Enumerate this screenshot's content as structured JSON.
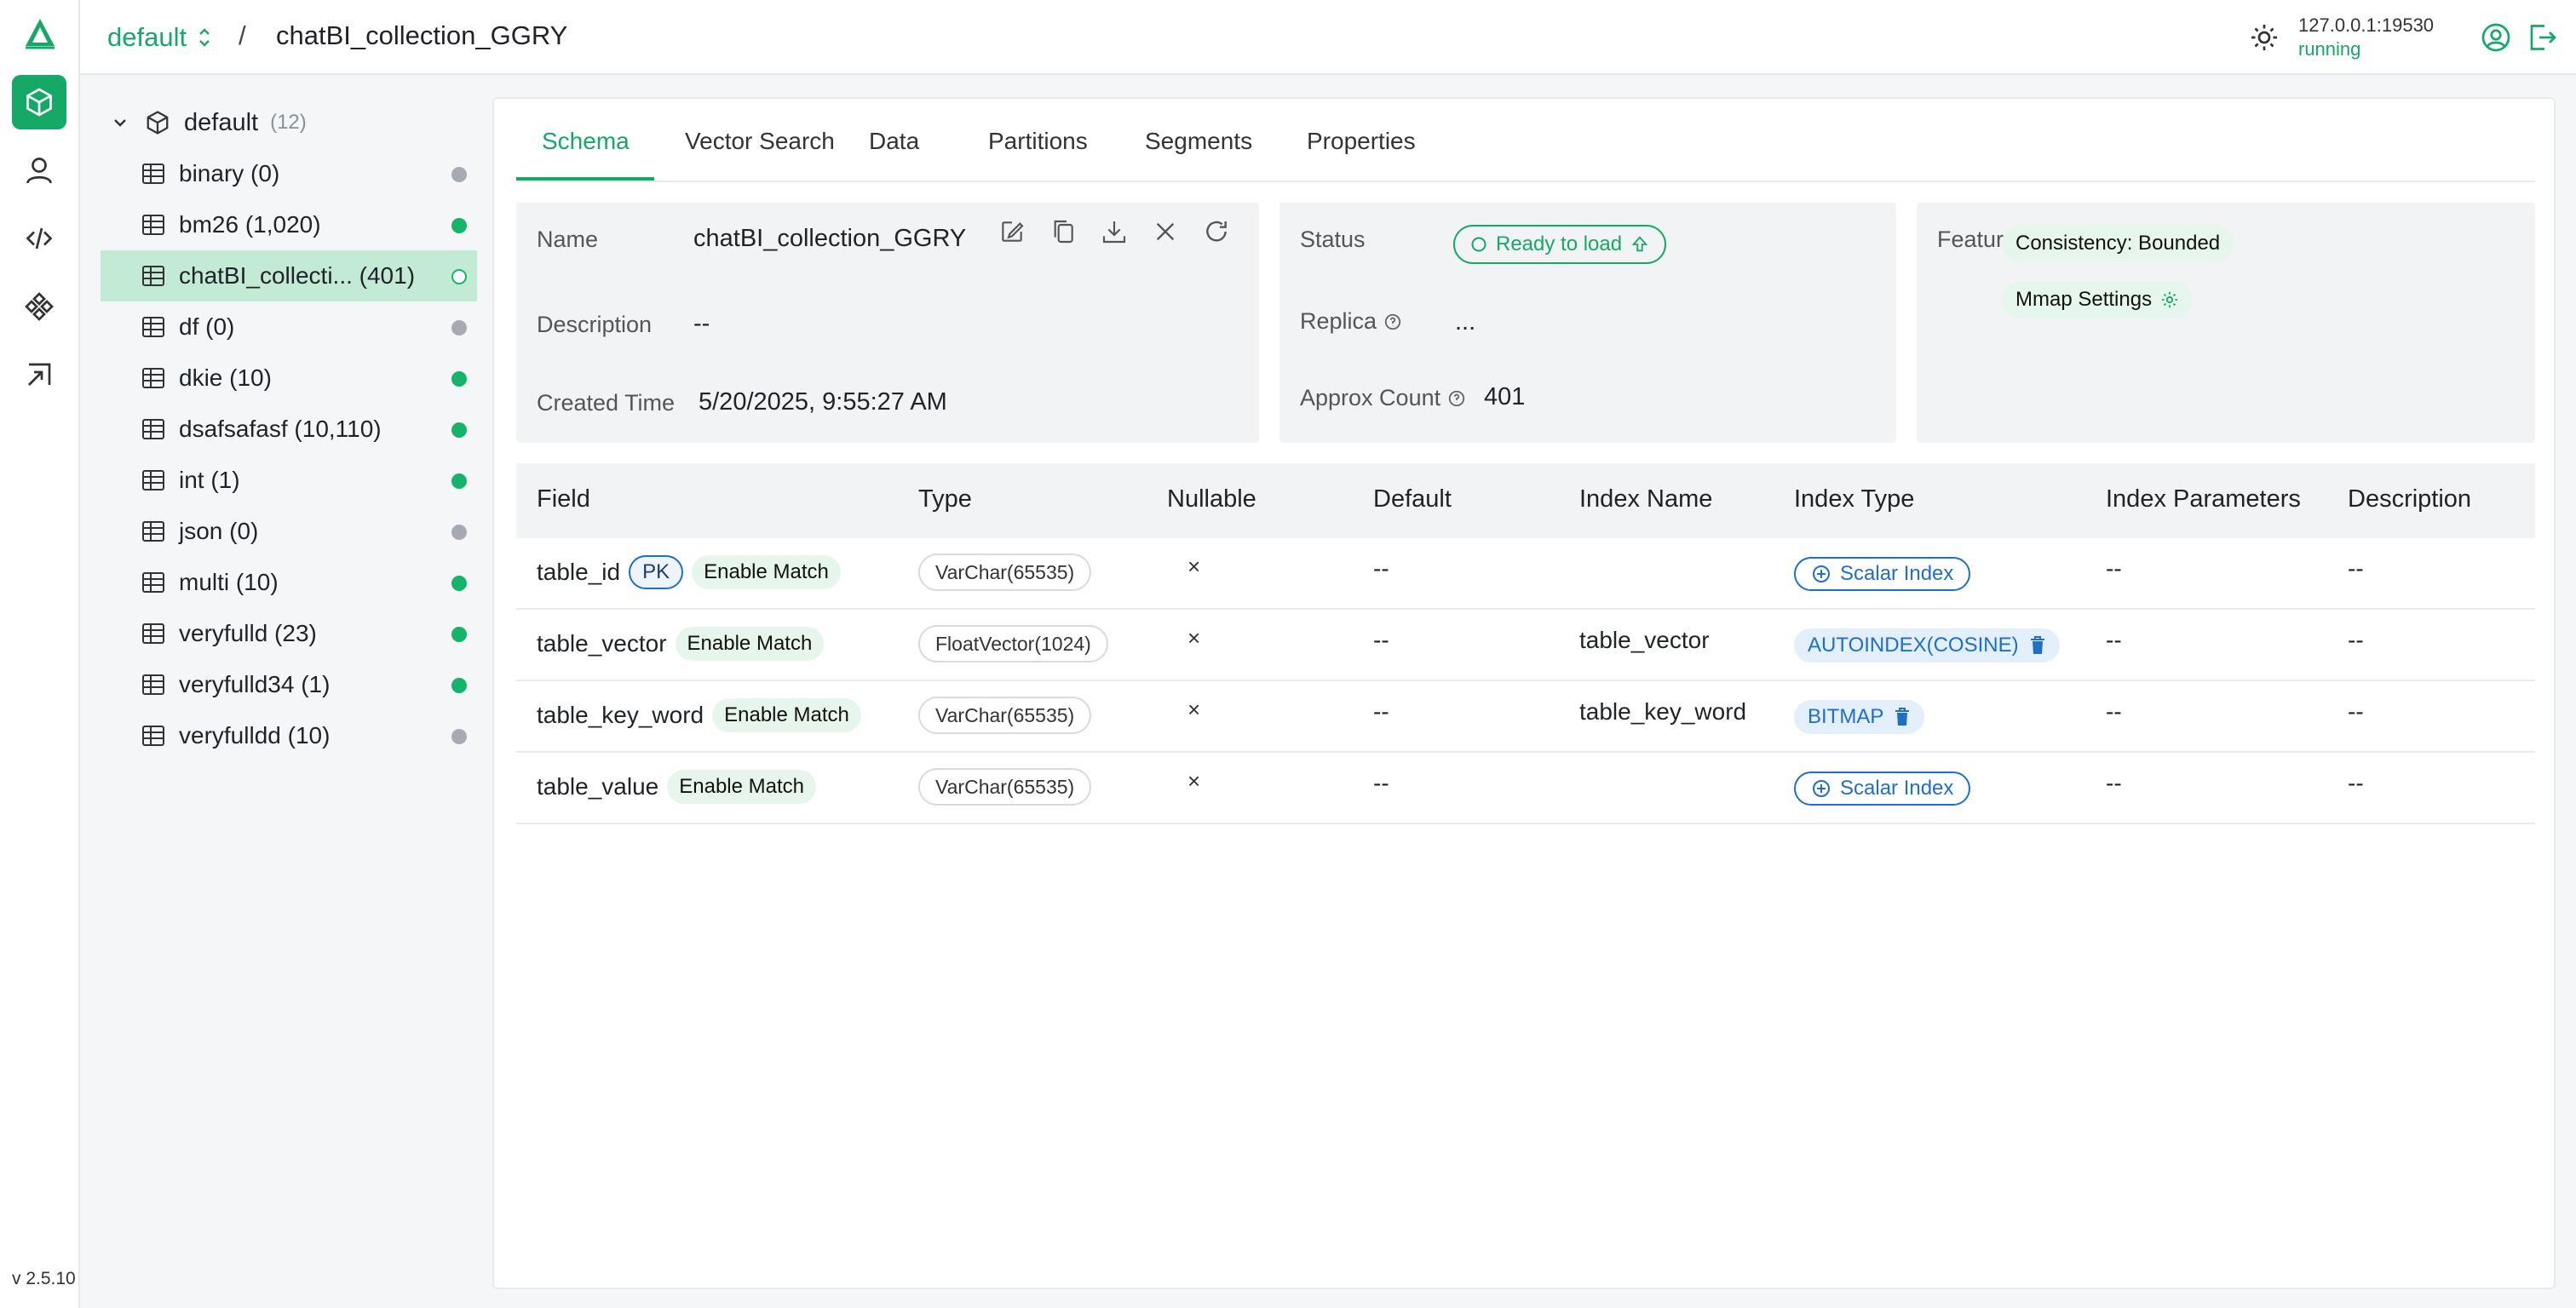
{
  "rail": {
    "version": "v 2.5.10",
    "nav_icons": [
      "collections-icon",
      "user-icon",
      "code-icon",
      "system-icon",
      "slow-query-icon"
    ]
  },
  "header": {
    "database": "default",
    "separator": "/",
    "collection_title": "chatBI_collection_GGRY",
    "server_address": "127.0.0.1:19530",
    "server_status": "running"
  },
  "tree": {
    "root_label": "default",
    "root_count": "(12)",
    "items": [
      {
        "label": "binary",
        "count": "(0)",
        "state": "unloaded"
      },
      {
        "label": "bm26",
        "count": "(1,020)",
        "state": "loaded"
      },
      {
        "label": "chatBI_collecti...",
        "count": "(401)",
        "state": "loading"
      },
      {
        "label": "df",
        "count": "(0)",
        "state": "unloaded"
      },
      {
        "label": "dkie",
        "count": "(10)",
        "state": "loaded"
      },
      {
        "label": "dsafsafasf",
        "count": "(10,110)",
        "state": "loaded"
      },
      {
        "label": "int",
        "count": "(1)",
        "state": "loaded"
      },
      {
        "label": "json",
        "count": "(0)",
        "state": "unloaded"
      },
      {
        "label": "multi",
        "count": "(10)",
        "state": "loaded"
      },
      {
        "label": "veryfulld",
        "count": "(23)",
        "state": "loaded"
      },
      {
        "label": "veryfulld34",
        "count": "(1)",
        "state": "loaded"
      },
      {
        "label": "veryfulldd",
        "count": "(10)",
        "state": "unloaded"
      }
    ]
  },
  "tabs": [
    "Schema",
    "Vector Search",
    "Data",
    "Partitions",
    "Segments",
    "Properties"
  ],
  "info": {
    "name_label": "Name",
    "name_value": "chatBI_collection_GGRY",
    "description_label": "Description",
    "description_value": "--",
    "created_label": "Created Time",
    "created_value": "5/20/2025, 9:55:27 AM",
    "status_label": "Status",
    "status_value": "Ready to load",
    "replica_label": "Replica",
    "replica_value": "...",
    "approx_label": "Approx Count",
    "approx_value": "401",
    "features_label": "Features",
    "consistency": "Consistency: Bounded",
    "mmap": "Mmap Settings"
  },
  "schema": {
    "headers": [
      "Field",
      "Type",
      "Nullable",
      "Default",
      "Index Name",
      "Index Type",
      "Index Parameters",
      "Description"
    ],
    "rows": [
      {
        "field": "table_id",
        "pk": "PK",
        "match": "Enable Match",
        "type": "VarChar(65535)",
        "nullable": "×",
        "default": "--",
        "index_name": "",
        "index_type": "Scalar Index",
        "index_kind": "add",
        "params": "--",
        "description": "--"
      },
      {
        "field": "table_vector",
        "pk": "",
        "match": "Enable Match",
        "type": "FloatVector(1024)",
        "nullable": "×",
        "default": "--",
        "index_name": "table_vector",
        "index_type": "AUTOINDEX(COSINE)",
        "index_kind": "existing",
        "params": "--",
        "description": "--"
      },
      {
        "field": "table_key_word",
        "pk": "",
        "match": "Enable Match",
        "type": "VarChar(65535)",
        "nullable": "×",
        "default": "--",
        "index_name": "table_key_word",
        "index_type": "BITMAP",
        "index_kind": "existing",
        "params": "--",
        "description": "--"
      },
      {
        "field": "table_value",
        "pk": "",
        "match": "Enable Match",
        "type": "VarChar(65535)",
        "nullable": "×",
        "default": "--",
        "index_name": "",
        "index_type": "Scalar Index",
        "index_kind": "add",
        "params": "--",
        "description": "--"
      }
    ]
  },
  "colors": {
    "accent": "#16a866",
    "link": "#1e6fc7"
  }
}
